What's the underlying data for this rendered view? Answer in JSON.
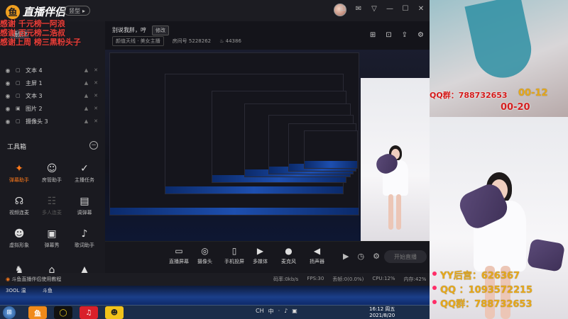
{
  "app": {
    "name": "直播伴侣",
    "mode": "竖型"
  },
  "window_controls": [
    "⊡",
    "✉",
    "▽",
    "—",
    "☐",
    "✕"
  ],
  "chat_overlay": [
    "感谢 千元榜一阿浪",
    "感谢 百元榜二浩叔",
    "感谢上周    榜三黑粉头子"
  ],
  "scene": {
    "tag": "场景2"
  },
  "sources": [
    {
      "label": "文本 4",
      "locked": false
    },
    {
      "label": "主屏 1",
      "locked": false
    },
    {
      "label": "文本 3",
      "locked": false
    },
    {
      "label": "图片 2",
      "locked": true
    },
    {
      "label": "摄像头 3",
      "locked": false
    }
  ],
  "tools": {
    "header": "工具箱",
    "items": [
      {
        "label": "弹幕助手",
        "icon": "✦",
        "active": true,
        "disabled": false
      },
      {
        "label": "房管助手",
        "icon": "☺",
        "active": false,
        "disabled": false
      },
      {
        "label": "主播任务",
        "icon": "✓",
        "active": false,
        "disabled": false
      },
      {
        "label": "视频连麦",
        "icon": "☊",
        "active": false,
        "disabled": false
      },
      {
        "label": "多人连麦",
        "icon": "☷",
        "active": false,
        "disabled": true
      },
      {
        "label": "调弹幕",
        "icon": "▤",
        "active": false,
        "disabled": false
      },
      {
        "label": "虚拟形象",
        "icon": "☻",
        "active": false,
        "disabled": false
      },
      {
        "label": "弹幕秀",
        "icon": "▣",
        "active": false,
        "disabled": false
      },
      {
        "label": "歌词助手",
        "icon": "♪",
        "active": false,
        "disabled": false
      },
      {
        "label": "",
        "icon": "♞",
        "active": false,
        "disabled": false
      },
      {
        "label": "",
        "icon": "⌂",
        "active": false,
        "disabled": false
      },
      {
        "label": "",
        "icon": "▲",
        "active": false,
        "disabled": false
      }
    ]
  },
  "room": {
    "title": "别说我胖，哼",
    "edit_label": "修改",
    "category": "颜值天线 · 美女主播",
    "room_id": "5228262",
    "popularity": "44386"
  },
  "controls": [
    {
      "label": "直播屏幕",
      "icon": "▭"
    },
    {
      "label": "摄像头",
      "icon": "◎"
    },
    {
      "label": "手机投屏",
      "icon": "▯"
    },
    {
      "label": "多媒体",
      "icon": "▶"
    },
    {
      "label": "麦克风",
      "icon": "●"
    },
    {
      "label": "扬声器",
      "icon": "◀"
    }
  ],
  "live_button": "开始直播",
  "status": {
    "tip": "斗鱼直播伴侣使用教程",
    "bitrate": "码率:0kb/s",
    "fps": "FPS:30",
    "dropped": "丢帧:0(0.0%)",
    "cpu": "CPU:12%",
    "mem": "内存:42%"
  },
  "desktop_labels": [
    "3OOL 温",
    "斗鱼"
  ],
  "clock": {
    "time": "16:12 周五",
    "date": "2021/8/20"
  },
  "tray_items": [
    "CH",
    "中",
    "·",
    "♪",
    "▣"
  ],
  "camera_overlay": {
    "qq_group_top": "QQ群：788732653",
    "time_text": "00-12",
    "time_text2": "00-20",
    "yy_label": "YY后宫：626367",
    "qq_label": "QQ   ：1093572215",
    "qq_group_label": "QQ群：788732653"
  }
}
